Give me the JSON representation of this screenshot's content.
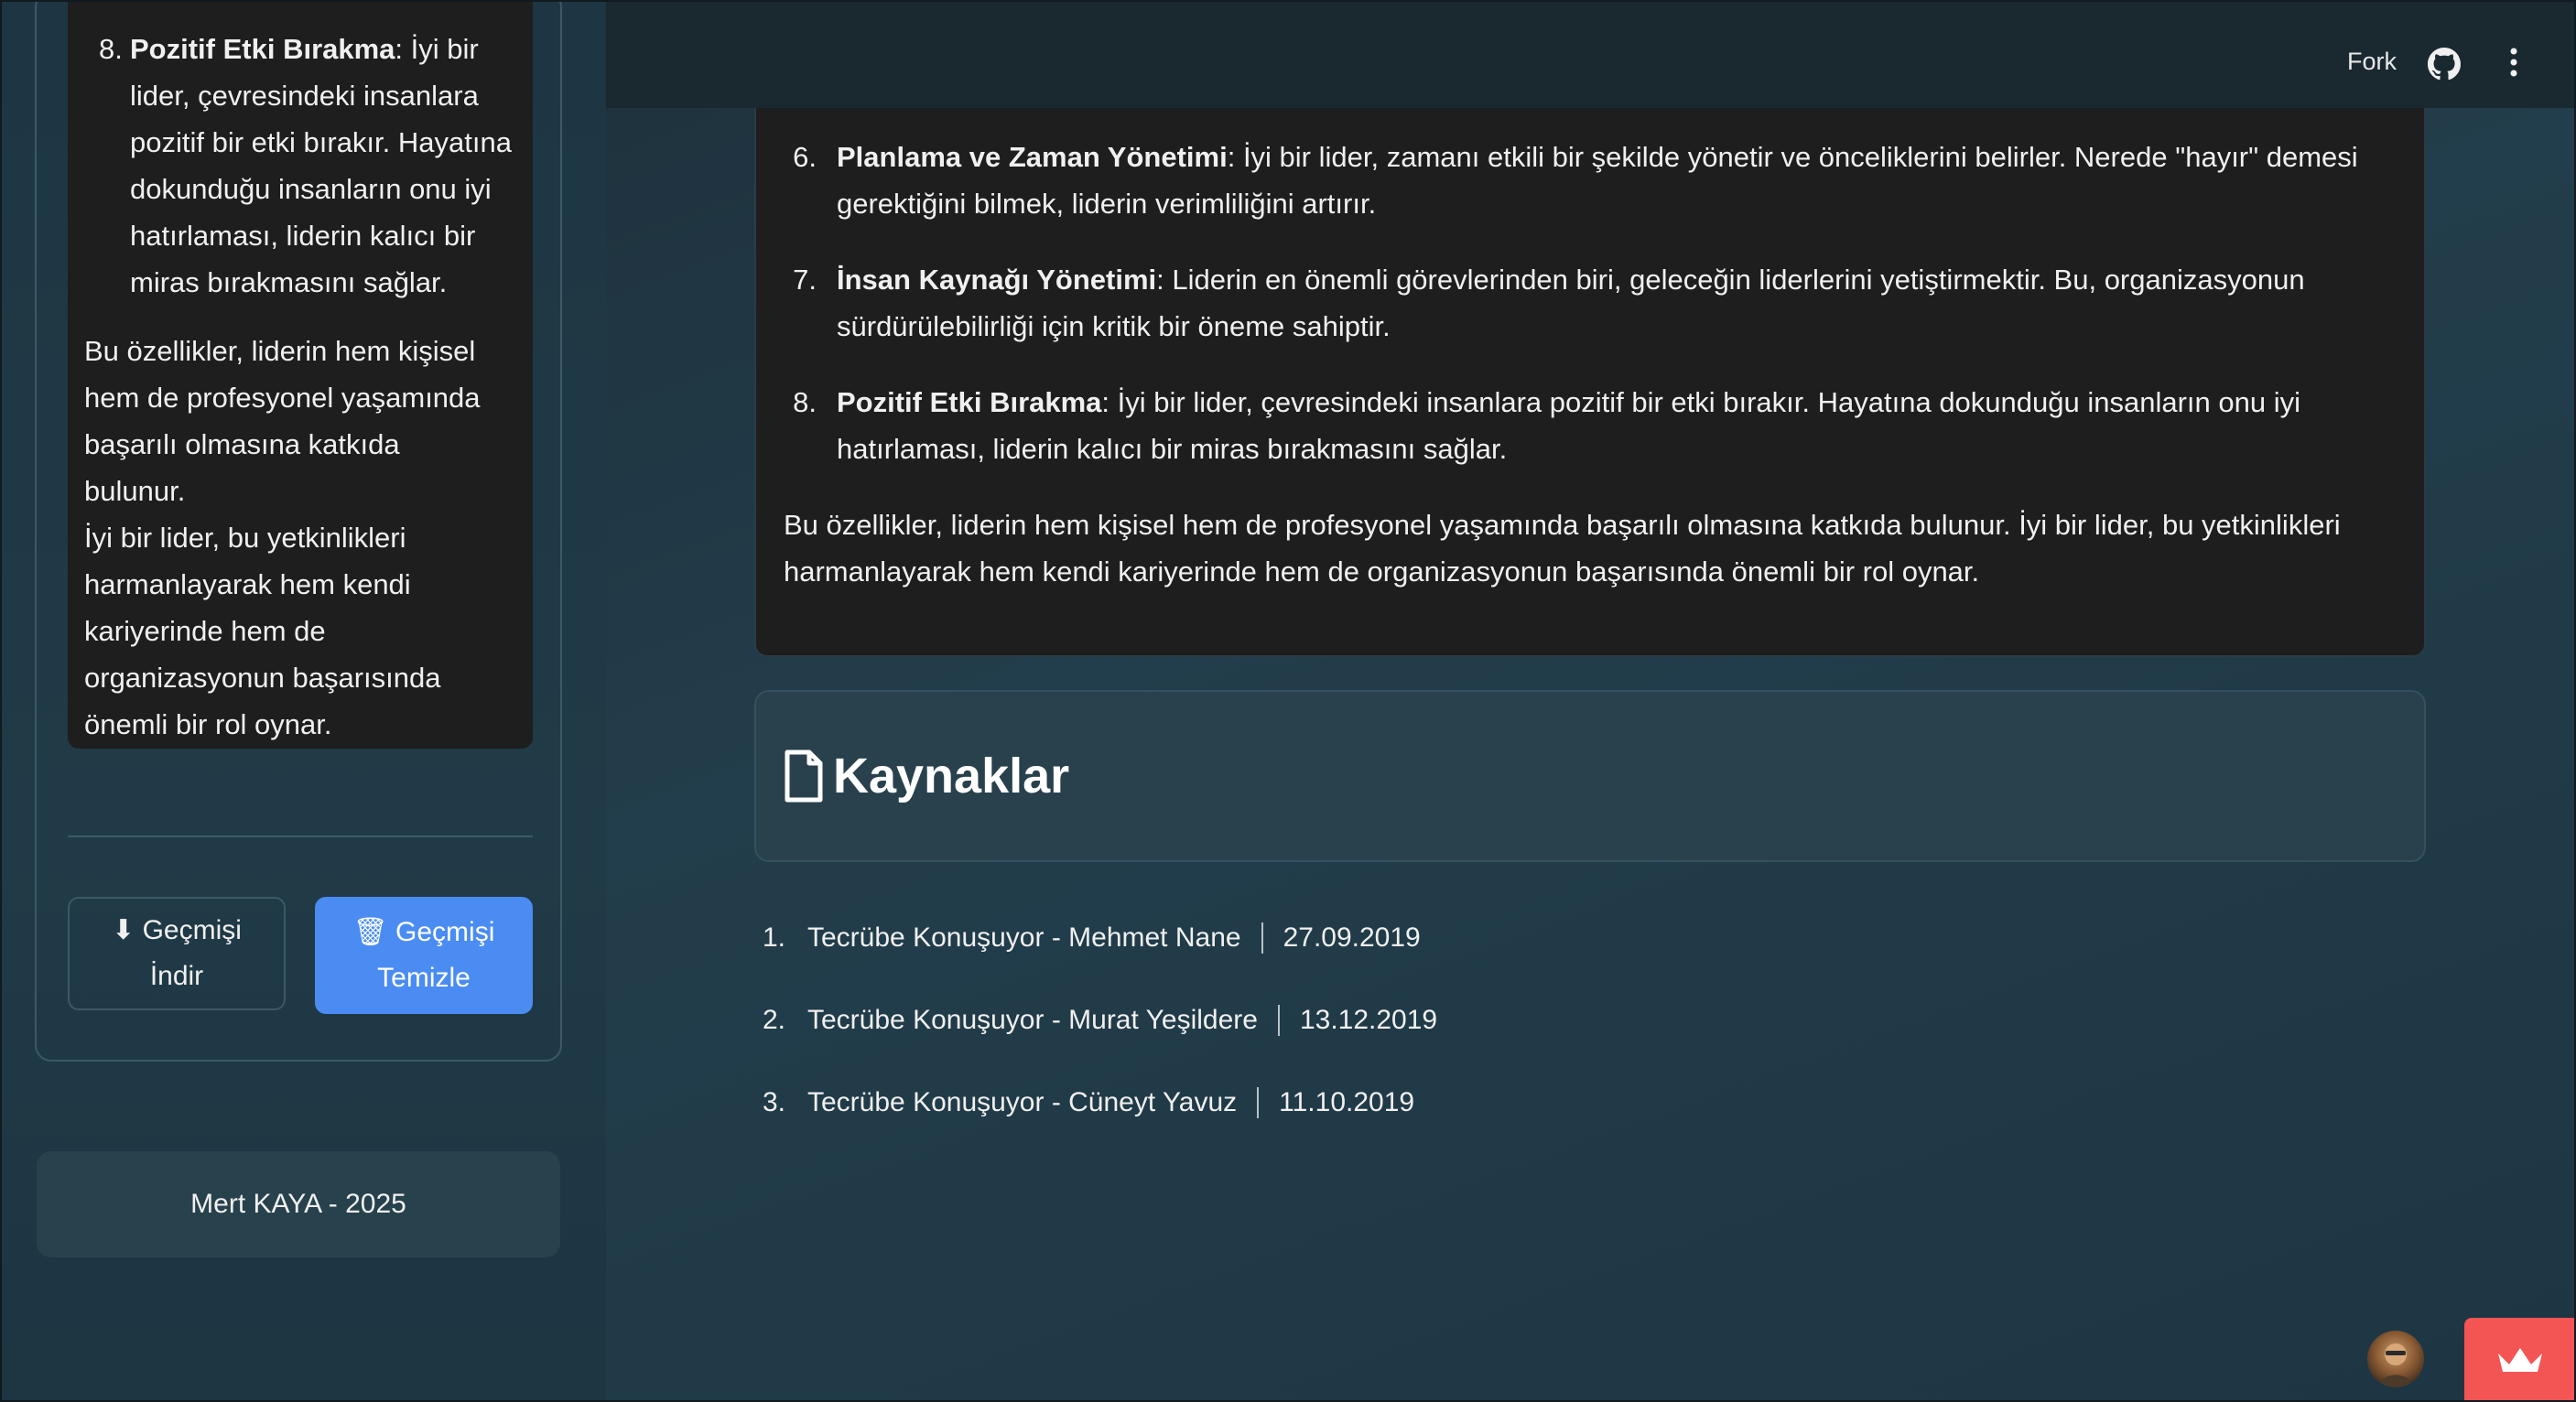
{
  "sidebar": {
    "chat_item": {
      "num": "8.",
      "bold": "Pozitif Etki Bırakma",
      "lines": [
        "İyi bir",
        "lider, çevresindeki insanlara",
        "pozitif bir etki bırakır. Hayatına",
        "dokunduğu insanların onu iyi",
        "hatırlaması, liderin kalıcı bir",
        "miras bırakmasını sağlar."
      ]
    },
    "chat_paragraph_lines": [
      "Bu özellikler, liderin hem kişisel",
      "hem de profesyonel yaşamında",
      "başarılı olmasına katkıda bulunur.",
      "İyi bir lider, bu yetkinlikleri",
      "harmanlayarak hem kendi",
      "kariyerinde hem de",
      "organizasyonun başarısında",
      "önemli bir rol oynar."
    ],
    "download_button": {
      "line1": "⬇ Geçmişi",
      "line2": "İndir"
    },
    "clear_button": {
      "line1": "🗑 Geçmişi",
      "line2": "Temizle"
    },
    "footer": "Mert KAYA - 2025"
  },
  "header": {
    "fork_label": "Fork",
    "icons": [
      "github-icon",
      "more-vertical-icon"
    ]
  },
  "answer": {
    "items": [
      {
        "num": "6.",
        "bold": "Planlama ve Zaman Yönetimi",
        "line1": ": İyi bir lider, zamanı etkili bir şekilde yönetir ve önceliklerini belirler. Nerede \"hayır\" demesi",
        "line2": "gerektiğini bilmek, liderin verimliliğini artırır."
      },
      {
        "num": "7.",
        "bold": "İnsan Kaynağı Yönetimi",
        "line1": ": Liderin en önemli görevlerinden biri, geleceğin liderlerini yetiştirmektir. Bu, organizasyonun",
        "line2": "sürdürülebilirliği için kritik bir öneme sahiptir."
      },
      {
        "num": "8.",
        "bold": "Pozitif Etki Bırakma",
        "line1": ": İyi bir lider, çevresindeki insanlara pozitif bir etki bırakır. Hayatına dokunduğu insanların onu iyi",
        "line2": "hatırlaması, liderin kalıcı bir miras bırakmasını sağlar."
      }
    ],
    "paragraph_line1": "Bu özellikler, liderin hem kişisel hem de profesyonel yaşamında başarılı olmasına katkıda bulunur. İyi bir lider, bu yetkinlikleri",
    "paragraph_line2": "harmanlayarak hem kendi kariyerinde hem de organizasyonun başarısında önemli bir rol oynar."
  },
  "sources": {
    "title": "Kaynaklar",
    "icon": "document-icon",
    "items": [
      {
        "num": "1.",
        "title": "Tecrübe Konuşuyor - Mehmet Nane",
        "date": "27.09.2019"
      },
      {
        "num": "2.",
        "title": "Tecrübe Konuşuyor - Murat Yeşildere",
        "date": "13.12.2019"
      },
      {
        "num": "3.",
        "title": "Tecrübe Konuşuyor - Cüneyt Yavuz",
        "date": "11.10.2019"
      }
    ]
  },
  "colors": {
    "accent_button": "#4a8cf2",
    "crown_badge": "#f35454",
    "card_dark": "#1e1e1e",
    "sources_card": "#29414d"
  }
}
